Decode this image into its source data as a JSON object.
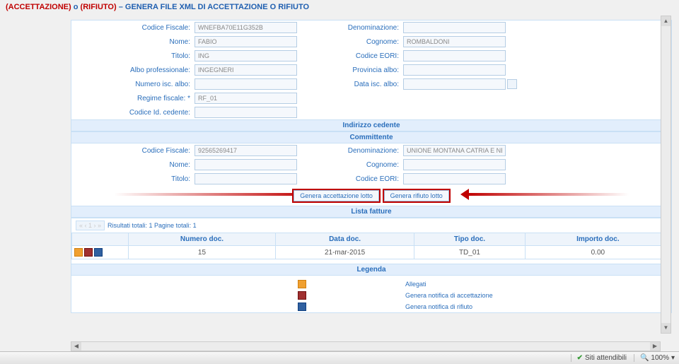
{
  "header": {
    "part1": "(ACCETTAZIONE)",
    "part2": " o ",
    "part3": "(RIFIUTO)",
    "part4": " – GENERA FILE XML DI ACCETTAZIONE O RIFIUTO"
  },
  "form_top": {
    "rows": [
      {
        "label1": "Codice Fiscale:",
        "val1": "WNEFBA70E11G352B",
        "label2": "Denominazione:",
        "val2": ""
      },
      {
        "label1": "Nome:",
        "val1": "FABIO",
        "label2": "Cognome:",
        "val2": "ROMBALDONI"
      },
      {
        "label1": "Titolo:",
        "val1": "ING",
        "label2": "Codice EORI:",
        "val2": ""
      },
      {
        "label1": "Albo professionale:",
        "val1": "INGEGNERI",
        "label2": "Provincia albo:",
        "val2": ""
      },
      {
        "label1": "Numero isc. albo:",
        "val1": "",
        "label2": "Data isc. albo:",
        "val2": "",
        "date": true
      },
      {
        "label1": "Regime fiscale: *",
        "val1": "RF_01",
        "single": true
      },
      {
        "label1": "Codice Id. cedente:",
        "val1": "",
        "single": true
      }
    ]
  },
  "sections": {
    "indirizzo": "Indirizzo cedente",
    "committente": "Committente"
  },
  "form_committente": {
    "rows": [
      {
        "label1": "Codice Fiscale:",
        "val1": "92565269417",
        "label2": "Denominazione:",
        "val2": "UNIONE MONTANA CATRIA E NERO"
      },
      {
        "label1": "Nome:",
        "val1": "",
        "label2": "Cognome:",
        "val2": ""
      },
      {
        "label1": "Titolo:",
        "val1": "",
        "label2": "Codice EORI:",
        "val2": ""
      }
    ]
  },
  "buttons": {
    "accettazione": "Genera accettazione lotto",
    "rifiuto": "Genera rifiuto lotto"
  },
  "lista_fatture": {
    "title": "Lista fatture",
    "results": "Risultati totali: 1 Pagine totali: 1",
    "columns": [
      "",
      "Numero doc.",
      "Data doc.",
      "Tipo doc.",
      "Importo doc."
    ],
    "rows": [
      {
        "numero": "15",
        "data": "21-mar-2015",
        "tipo": "TD_01",
        "importo": "0.00"
      }
    ]
  },
  "legenda": {
    "title": "Legenda",
    "items": [
      {
        "icon": "icon-a",
        "label": "Allegati"
      },
      {
        "icon": "icon-b",
        "label": "Genera notifica di accettazione"
      },
      {
        "icon": "icon-c",
        "label": "Genera notifica di rifiuto"
      }
    ]
  },
  "statusbar": {
    "siti": "Siti attendibili",
    "zoom": "100%"
  }
}
